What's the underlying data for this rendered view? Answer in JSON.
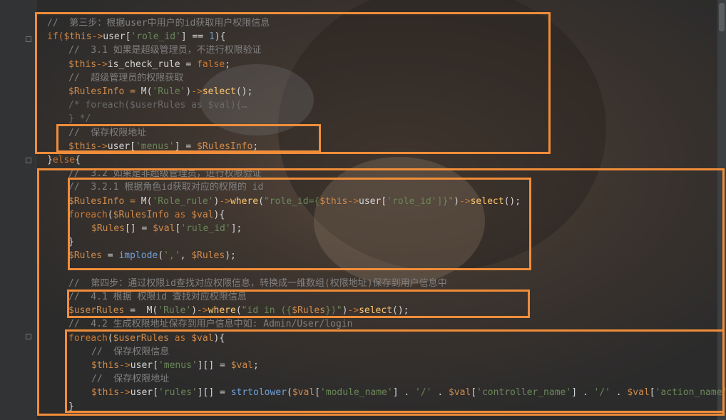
{
  "editor": {
    "lines": [
      {
        "indent": 0,
        "tokens": [
          {
            "t": "//  第三步：根据user中用户的id获取用户权限信息",
            "c": "cmt"
          }
        ]
      },
      {
        "indent": 0,
        "tokens": [
          {
            "t": "if(",
            "c": "kw"
          },
          {
            "t": "$this",
            "c": "var"
          },
          {
            "t": "->",
            "c": "kw"
          },
          {
            "t": "user[",
            "c": "pl"
          },
          {
            "t": "'role_id'",
            "c": "str"
          },
          {
            "t": "] == ",
            "c": "pl"
          },
          {
            "t": "1",
            "c": "num"
          },
          {
            "t": "){",
            "c": "pl"
          }
        ]
      },
      {
        "indent": 1,
        "tokens": [
          {
            "t": "//  3.1 如果是超级管理员，不进行权限验证",
            "c": "cmt"
          }
        ]
      },
      {
        "indent": 1,
        "tokens": [
          {
            "t": "$this",
            "c": "var"
          },
          {
            "t": "->",
            "c": "kw"
          },
          {
            "t": "is_check_rule = ",
            "c": "pl"
          },
          {
            "t": "false",
            "c": "kw"
          },
          {
            "t": ";",
            "c": "pl"
          }
        ]
      },
      {
        "indent": 1,
        "tokens": [
          {
            "t": "//  超级管理员的权限获取",
            "c": "cmt"
          }
        ]
      },
      {
        "indent": 1,
        "tokens": [
          {
            "t": "$RulesInfo = ",
            "c": "var"
          },
          {
            "t": "M(",
            "c": "pl"
          },
          {
            "t": "'Rule'",
            "c": "str"
          },
          {
            "t": ")",
            "c": "pl"
          },
          {
            "t": "->",
            "c": "kw"
          },
          {
            "t": "select",
            "c": "fn"
          },
          {
            "t": "();",
            "c": "pl"
          }
        ]
      },
      {
        "indent": 1,
        "tokens": [
          {
            "t": "/* foreach($userRules as $val){…",
            "c": "faint"
          }
        ]
      },
      {
        "indent": 1,
        "tokens": [
          {
            "t": "} */",
            "c": "faint"
          }
        ]
      },
      {
        "indent": 1,
        "tokens": [
          {
            "t": "//  保存权限地址",
            "c": "cmt"
          }
        ]
      },
      {
        "indent": 1,
        "tokens": [
          {
            "t": "$this",
            "c": "var"
          },
          {
            "t": "->",
            "c": "kw"
          },
          {
            "t": "user[",
            "c": "pl"
          },
          {
            "t": "'menus'",
            "c": "str"
          },
          {
            "t": "] = ",
            "c": "pl"
          },
          {
            "t": "$RulesInfo",
            "c": "var"
          },
          {
            "t": ";",
            "c": "pl"
          }
        ]
      },
      {
        "indent": 0,
        "tokens": [
          {
            "t": "}",
            "c": "pl"
          },
          {
            "t": "else",
            "c": "kw"
          },
          {
            "t": "{",
            "c": "pl"
          }
        ]
      },
      {
        "indent": 1,
        "tokens": [
          {
            "t": "//  3.2 如果是非超级管理员，进行权限验证",
            "c": "cmt"
          }
        ]
      },
      {
        "indent": 1,
        "tokens": [
          {
            "t": "//  3.2.1 根据角色id获取对应的权限的 id",
            "c": "cmt"
          }
        ]
      },
      {
        "indent": 1,
        "tokens": [
          {
            "t": "$RulesInfo = ",
            "c": "var"
          },
          {
            "t": "M(",
            "c": "pl"
          },
          {
            "t": "'Role_rule'",
            "c": "str"
          },
          {
            "t": ")",
            "c": "pl"
          },
          {
            "t": "->",
            "c": "kw"
          },
          {
            "t": "where",
            "c": "fn"
          },
          {
            "t": "(",
            "c": "pl"
          },
          {
            "t": "\"role_id={",
            "c": "str"
          },
          {
            "t": "$this",
            "c": "var"
          },
          {
            "t": "->",
            "c": "kw"
          },
          {
            "t": "user[",
            "c": "pl"
          },
          {
            "t": "'role_id'",
            "c": "str"
          },
          {
            "t": "]}\"",
            "c": "str"
          },
          {
            "t": ")",
            "c": "pl"
          },
          {
            "t": "->",
            "c": "kw"
          },
          {
            "t": "select",
            "c": "fn"
          },
          {
            "t": "();",
            "c": "pl"
          }
        ]
      },
      {
        "indent": 1,
        "tokens": [
          {
            "t": "foreach",
            "c": "kw"
          },
          {
            "t": "(",
            "c": "pl"
          },
          {
            "t": "$RulesInfo",
            "c": "var"
          },
          {
            "t": " as ",
            "c": "kw"
          },
          {
            "t": "$val",
            "c": "var"
          },
          {
            "t": "){",
            "c": "pl"
          }
        ]
      },
      {
        "indent": 2,
        "tokens": [
          {
            "t": "$Rules",
            "c": "var"
          },
          {
            "t": "[] = ",
            "c": "pl"
          },
          {
            "t": "$val",
            "c": "var"
          },
          {
            "t": "[",
            "c": "pl"
          },
          {
            "t": "'rule_id'",
            "c": "str"
          },
          {
            "t": "];",
            "c": "pl"
          }
        ]
      },
      {
        "indent": 1,
        "tokens": [
          {
            "t": "}",
            "c": "pl"
          }
        ]
      },
      {
        "indent": 1,
        "tokens": [
          {
            "t": "$Rules",
            "c": "var"
          },
          {
            "t": " = ",
            "c": "pl"
          },
          {
            "t": "implode",
            "c": "bi"
          },
          {
            "t": "(",
            "c": "pl"
          },
          {
            "t": "','",
            "c": "str"
          },
          {
            "t": ", ",
            "c": "pl"
          },
          {
            "t": "$Rules",
            "c": "var"
          },
          {
            "t": ");",
            "c": "pl"
          }
        ]
      },
      {
        "indent": 1,
        "tokens": [
          {
            "t": "",
            "c": "pl"
          }
        ]
      },
      {
        "indent": 1,
        "tokens": [
          {
            "t": "//  第四步：通过权限id查找对应权限信息，转换成一维数组(权限地址)保存到用户信息中",
            "c": "cmt"
          }
        ]
      },
      {
        "indent": 1,
        "tokens": [
          {
            "t": "//  4.1 根据 权限id 查找对应权限信息",
            "c": "cmt"
          }
        ]
      },
      {
        "indent": 1,
        "tokens": [
          {
            "t": "$userRules",
            "c": "var"
          },
          {
            "t": " =  ",
            "c": "pl"
          },
          {
            "t": "M(",
            "c": "pl"
          },
          {
            "t": "'Rule'",
            "c": "str"
          },
          {
            "t": ")",
            "c": "pl"
          },
          {
            "t": "->",
            "c": "kw"
          },
          {
            "t": "where",
            "c": "fn"
          },
          {
            "t": "(",
            "c": "pl"
          },
          {
            "t": "\"id in ({",
            "c": "str"
          },
          {
            "t": "$Rules",
            "c": "var"
          },
          {
            "t": "})\"",
            "c": "str"
          },
          {
            "t": ")",
            "c": "pl"
          },
          {
            "t": "->",
            "c": "kw"
          },
          {
            "t": "select",
            "c": "fn"
          },
          {
            "t": "();",
            "c": "pl"
          }
        ]
      },
      {
        "indent": 1,
        "tokens": [
          {
            "t": "//  4.2 生成权限地址保存到用户信息中如: Admin/User/login",
            "c": "cmt"
          }
        ]
      },
      {
        "indent": 1,
        "tokens": [
          {
            "t": "foreach",
            "c": "kw"
          },
          {
            "t": "(",
            "c": "pl"
          },
          {
            "t": "$userRules",
            "c": "var"
          },
          {
            "t": " as ",
            "c": "kw"
          },
          {
            "t": "$val",
            "c": "var"
          },
          {
            "t": "){",
            "c": "pl"
          }
        ]
      },
      {
        "indent": 2,
        "tokens": [
          {
            "t": "//  保存权限信息",
            "c": "cmt"
          }
        ]
      },
      {
        "indent": 2,
        "tokens": [
          {
            "t": "$this",
            "c": "var"
          },
          {
            "t": "->",
            "c": "kw"
          },
          {
            "t": "user[",
            "c": "pl"
          },
          {
            "t": "'menus'",
            "c": "str"
          },
          {
            "t": "][] = ",
            "c": "pl"
          },
          {
            "t": "$val",
            "c": "var"
          },
          {
            "t": ";",
            "c": "pl"
          }
        ]
      },
      {
        "indent": 2,
        "tokens": [
          {
            "t": "//  保存权限地址",
            "c": "cmt"
          }
        ]
      },
      {
        "indent": 2,
        "tokens": [
          {
            "t": "$this",
            "c": "var"
          },
          {
            "t": "->",
            "c": "kw"
          },
          {
            "t": "user[",
            "c": "pl"
          },
          {
            "t": "'rules'",
            "c": "str"
          },
          {
            "t": "][] = ",
            "c": "pl"
          },
          {
            "t": "strtolower",
            "c": "bi"
          },
          {
            "t": "(",
            "c": "pl"
          },
          {
            "t": "$val",
            "c": "var"
          },
          {
            "t": "[",
            "c": "pl"
          },
          {
            "t": "'module_name'",
            "c": "str"
          },
          {
            "t": "] . ",
            "c": "pl"
          },
          {
            "t": "'/'",
            "c": "str"
          },
          {
            "t": " . ",
            "c": "pl"
          },
          {
            "t": "$val",
            "c": "var"
          },
          {
            "t": "[",
            "c": "pl"
          },
          {
            "t": "'controller_name'",
            "c": "str"
          },
          {
            "t": "] . ",
            "c": "pl"
          },
          {
            "t": "'/'",
            "c": "str"
          },
          {
            "t": " . ",
            "c": "pl"
          },
          {
            "t": "$val",
            "c": "var"
          },
          {
            "t": "[",
            "c": "pl"
          },
          {
            "t": "'action_name'",
            "c": "str"
          }
        ]
      },
      {
        "indent": 1,
        "tokens": [
          {
            "t": "}",
            "c": "pl"
          }
        ]
      }
    ]
  },
  "colors": {
    "highlight_border": "#f08d3a",
    "background": "#2b2b2b",
    "comment": "#808080",
    "keyword": "#cc7832",
    "variable": "#d08b4b",
    "string": "#6a8759"
  },
  "icons": {
    "fold": "fold-marker-icon"
  }
}
